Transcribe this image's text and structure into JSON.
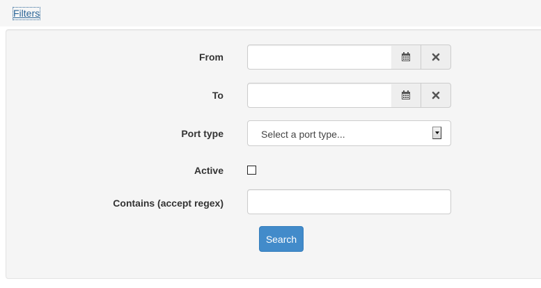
{
  "filters": {
    "toggle_label": "Filters"
  },
  "form": {
    "from": {
      "label": "From",
      "value": "",
      "calendar_icon": "calendar-icon",
      "clear_icon": "close-icon"
    },
    "to": {
      "label": "To",
      "value": "",
      "calendar_icon": "calendar-icon",
      "clear_icon": "close-icon"
    },
    "port_type": {
      "label": "Port type",
      "placeholder": "Select a port type..."
    },
    "active": {
      "label": "Active",
      "checked": false
    },
    "contains": {
      "label": "Contains (accept regex)",
      "value": ""
    },
    "search_label": "Search"
  },
  "colors": {
    "link": "#2a6496",
    "panel_bg": "#f5f5f5",
    "primary": "#428bca"
  }
}
